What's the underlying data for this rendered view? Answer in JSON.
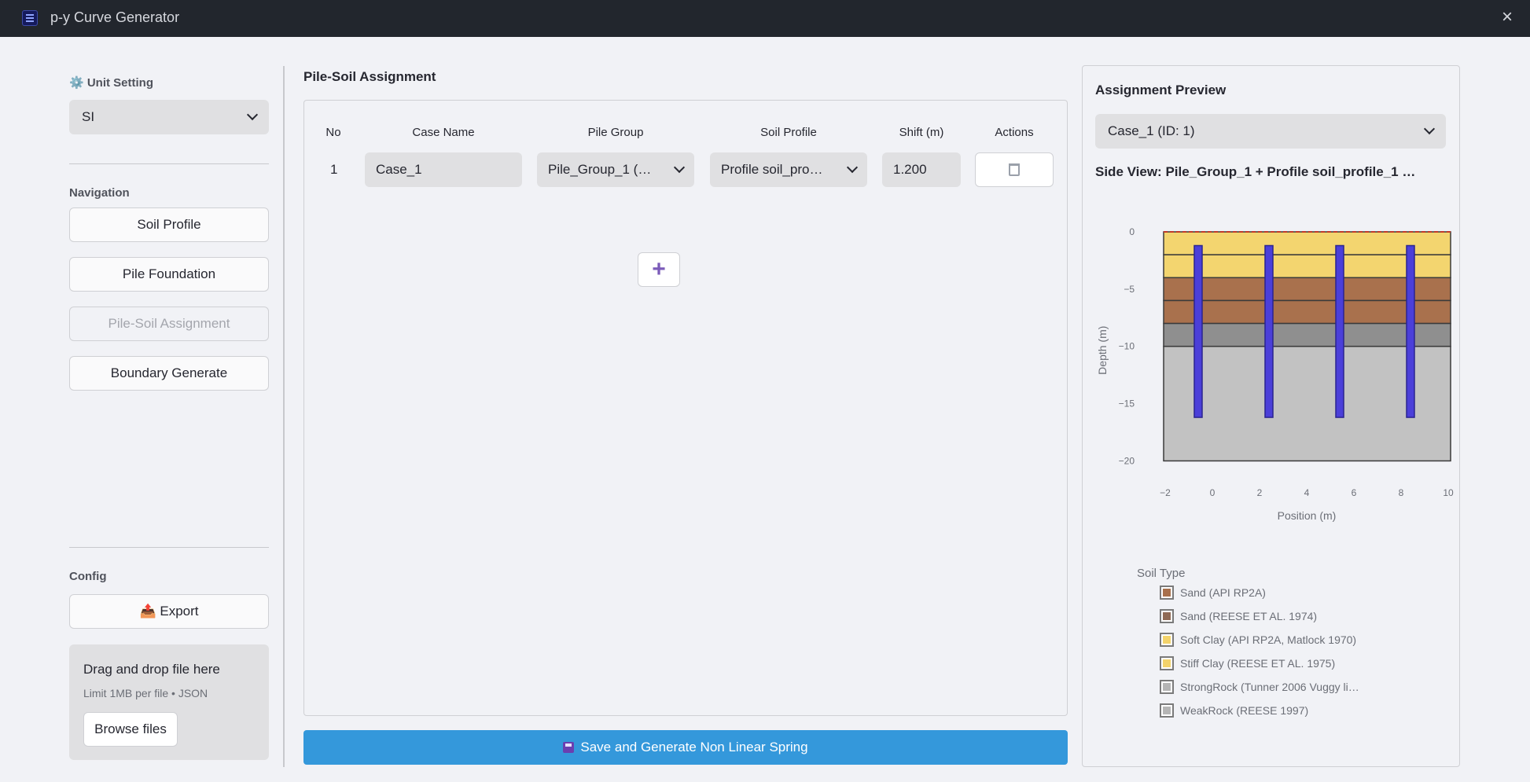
{
  "window": {
    "title": "p-y Curve Generator",
    "close_icon": "×"
  },
  "sidebar": {
    "unit_label": "⚙️ Unit Setting",
    "unit_value": "SI",
    "nav_label": "Navigation",
    "nav_items": [
      {
        "label": "Soil Profile",
        "disabled": false
      },
      {
        "label": "Pile Foundation",
        "disabled": false
      },
      {
        "label": "Pile-Soil Assignment",
        "disabled": true
      },
      {
        "label": "Boundary Generate",
        "disabled": false
      }
    ],
    "config_label": "Config",
    "export_label": "📤 Export",
    "dropzone": {
      "title": "Drag and drop file here",
      "limit": "Limit 1MB per file • JSON",
      "browse_label": "Browse files"
    }
  },
  "assignment": {
    "title": "Pile-Soil Assignment",
    "columns": [
      "No",
      "Case Name",
      "Pile Group",
      "Soil Profile",
      "Shift (m)",
      "Actions"
    ],
    "rows": [
      {
        "no": "1",
        "case_name": "Case_1",
        "pile_group": "Pile_Group_1 (…",
        "soil_profile": "Profile soil_pro…",
        "shift": "1.200"
      }
    ],
    "add_label": "+",
    "save_label": "Save and Generate Non Linear Spring"
  },
  "preview": {
    "title": "Assignment Preview",
    "case_select": "Case_1 (ID: 1)",
    "side_view_title": "Side View: Pile_Group_1 + Profile soil_profile_1 …",
    "legend_title": "Soil Type",
    "legend": [
      {
        "label": "Sand (API RP2A)",
        "color": "#a8704c"
      },
      {
        "label": "Sand (REESE ET AL. 1974)",
        "color": "#8f6a55"
      },
      {
        "label": "Soft Clay (API RP2A, Matlock 1970)",
        "color": "#f3d36b"
      },
      {
        "label": "Stiff Clay (REESE ET AL. 1975)",
        "color": "#f3d36b"
      },
      {
        "label": "StrongRock (Tunner 2006 Vuggy li…",
        "color": "#9a9a9a"
      },
      {
        "label": "WeakRock (REESE 1997)",
        "color": "#9a9a9a"
      }
    ]
  },
  "chart_data": {
    "type": "area",
    "title": "",
    "xlabel": "Position (m)",
    "ylabel": "Depth (m)",
    "xlim": [
      -2.5,
      10.5
    ],
    "ylim": [
      -21,
      0
    ],
    "x_ticks": [
      -2,
      0,
      2,
      4,
      6,
      8,
      10
    ],
    "y_ticks": [
      0,
      -5,
      -10,
      -15,
      -20
    ],
    "x_tick_labels": [
      "−2",
      "0",
      "2",
      "4",
      "6",
      "8",
      "10"
    ],
    "y_tick_labels": [
      "0",
      "−5",
      "−10",
      "−15",
      "−20"
    ],
    "soil_x_range": [
      -2.5,
      10.5
    ],
    "layers": [
      {
        "top": 0,
        "bottom": -2,
        "color": "#f3d56f"
      },
      {
        "top": -2,
        "bottom": -4,
        "color": "#f3d56f"
      },
      {
        "top": -4,
        "bottom": -6,
        "color": "#a9714d"
      },
      {
        "top": -6,
        "bottom": -8,
        "color": "#a9714d"
      },
      {
        "top": -8,
        "bottom": -10,
        "color": "#8f8f8f"
      },
      {
        "top": -10,
        "bottom": -20,
        "color": "#c2c2c2"
      }
    ],
    "piles": [
      {
        "x": -0.6,
        "top": -1.2,
        "bottom": -16.2
      },
      {
        "x": 2.4,
        "top": -1.2,
        "bottom": -16.2
      },
      {
        "x": 5.4,
        "top": -1.2,
        "bottom": -16.2
      },
      {
        "x": 8.4,
        "top": -1.2,
        "bottom": -16.2
      }
    ],
    "ground_line": 0,
    "grid": false,
    "legend_position": "bottom"
  }
}
